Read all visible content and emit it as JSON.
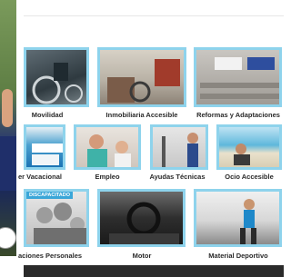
{
  "categories": [
    {
      "label": "Movilidad",
      "icon": "wheelchair-photo-icon"
    },
    {
      "label": "Inmobiliaria Accesible",
      "icon": "house-photo-icon"
    },
    {
      "label": "Reformas y Adaptaciones",
      "icon": "construction-photo-icon"
    },
    {
      "label": "er Vacacional",
      "icon": "vacation-photo-icon"
    },
    {
      "label": "Empleo",
      "icon": "employment-photo-icon"
    },
    {
      "label": "Ayudas Técnicas",
      "icon": "technical-aid-photo-icon"
    },
    {
      "label": "Ocio Accesible",
      "icon": "leisure-photo-icon"
    },
    {
      "label": "aciones Personales",
      "icon": "family-photo-icon",
      "badge": "DISCAPACITADO"
    },
    {
      "label": "Motor",
      "icon": "car-interior-photo-icon"
    },
    {
      "label": "Material Deportivo",
      "icon": "sports-photo-icon"
    }
  ],
  "colors": {
    "tile_border": "#8ed3ec",
    "badge": "#3aa6d8",
    "footer": "#2a2a2a"
  }
}
